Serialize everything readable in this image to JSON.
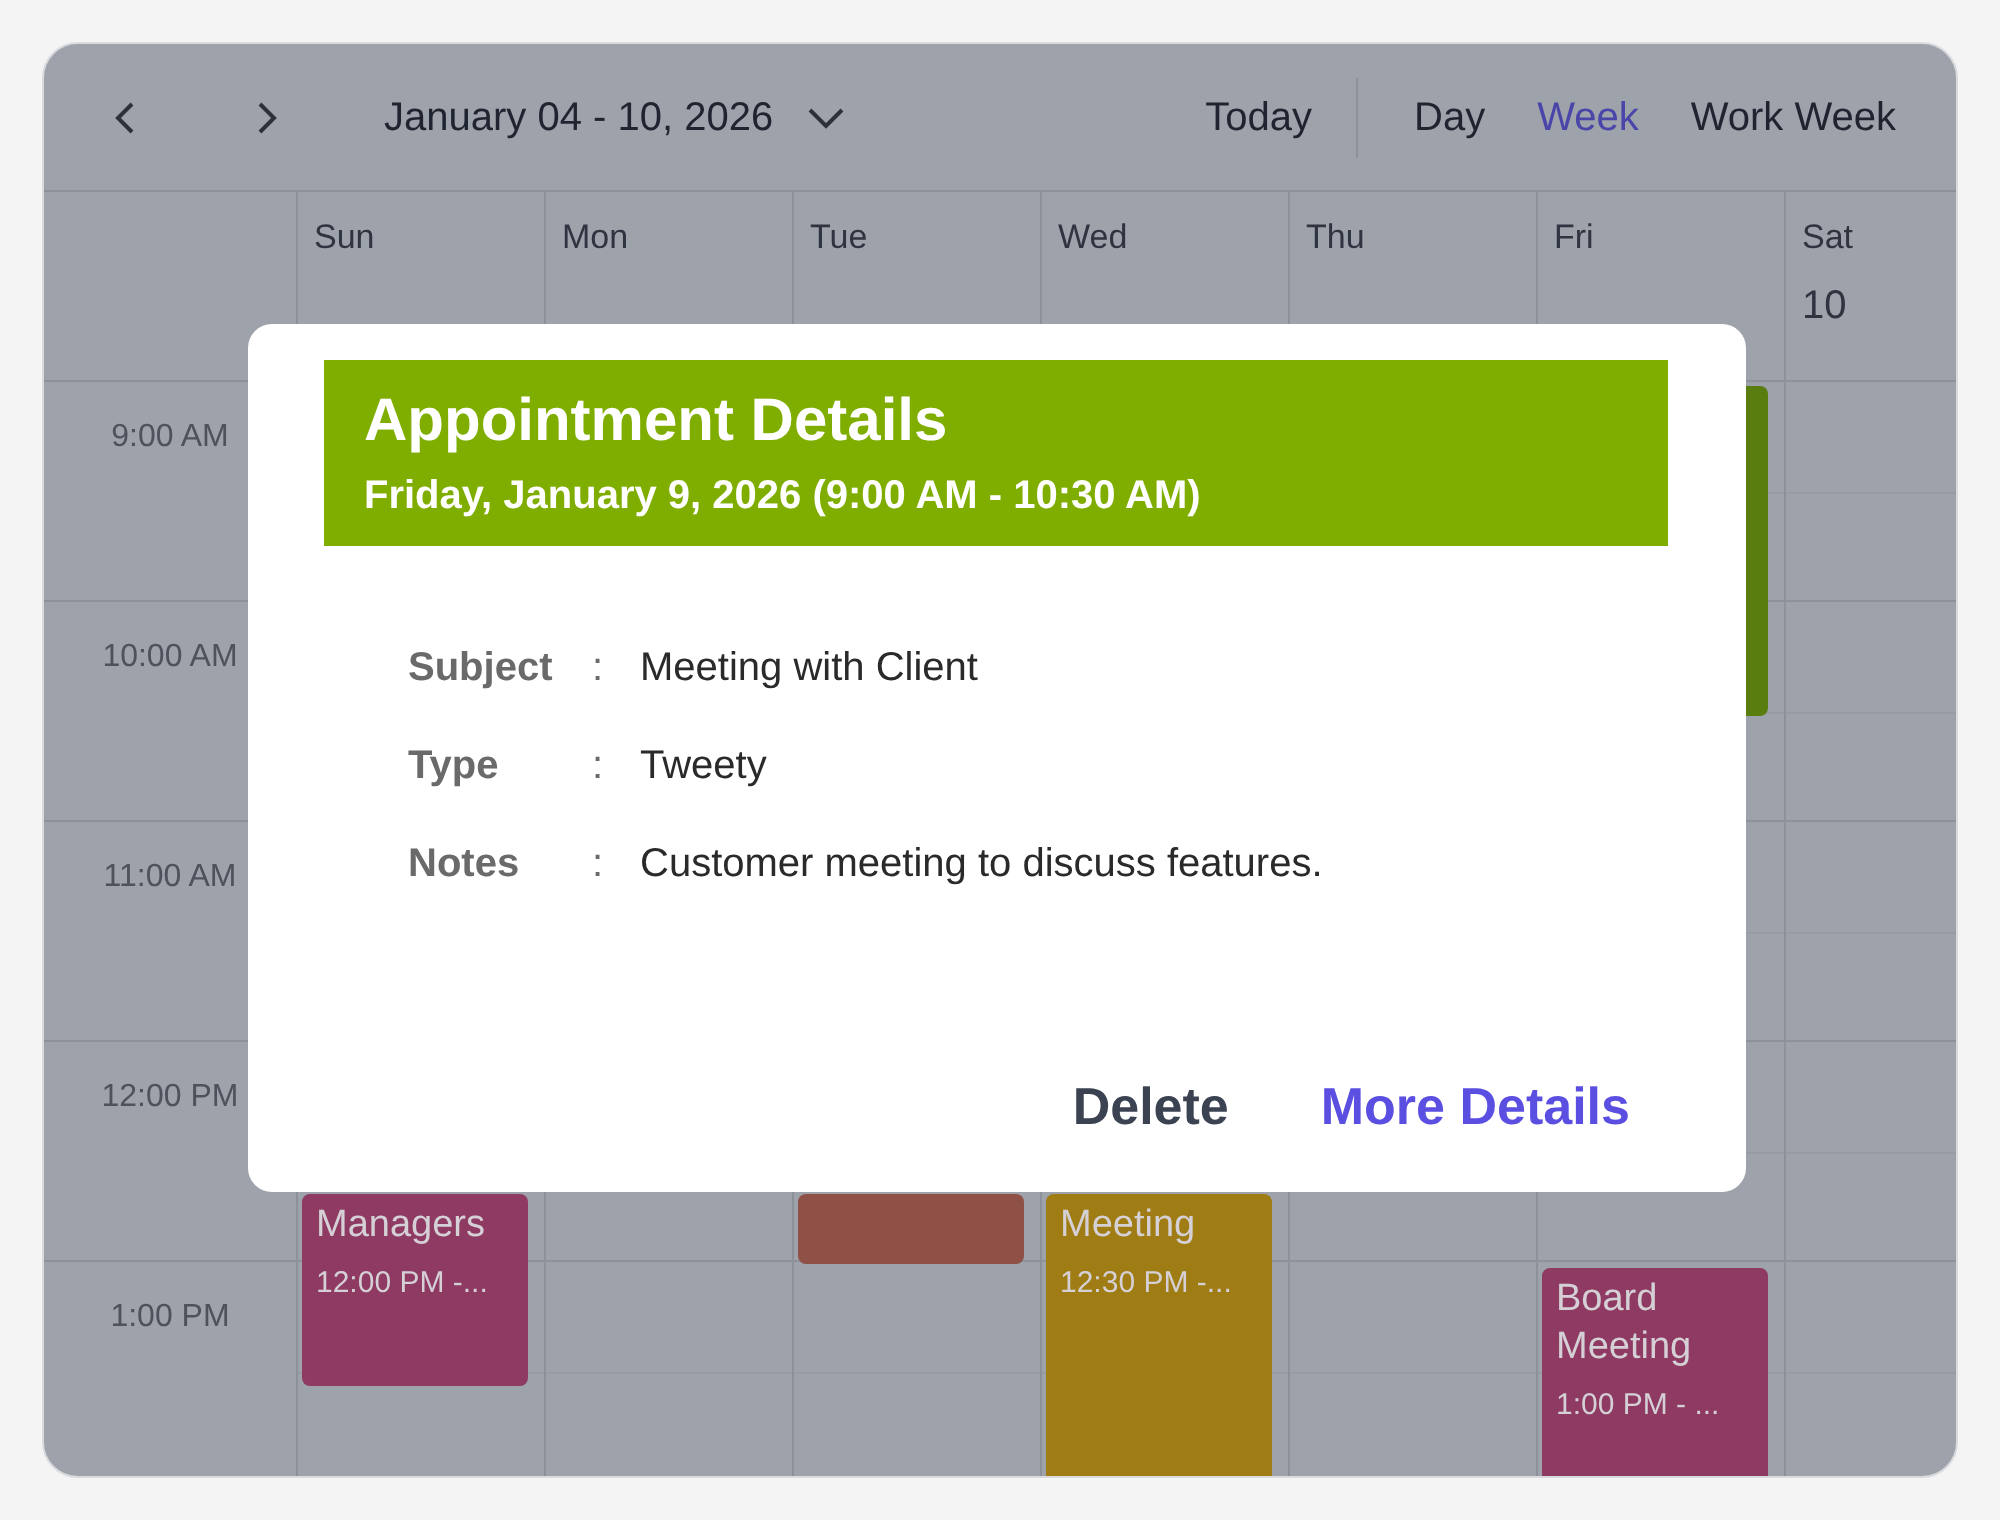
{
  "toolbar": {
    "date_range": "January 04 - 10, 2026",
    "today": "Today",
    "views": [
      {
        "label": "Day",
        "selected": false
      },
      {
        "label": "Week",
        "selected": true
      },
      {
        "label": "Work Week",
        "selected": false
      }
    ]
  },
  "days": [
    {
      "name": "Sun",
      "events": [
        {
          "title": "Managers",
          "time": "12:00 PM -...",
          "color": "#8e3a62"
        }
      ]
    },
    {
      "name": "Mon"
    },
    {
      "name": "Tue",
      "events": [
        {
          "color": "#8f5045"
        }
      ]
    },
    {
      "name": "Wed",
      "events": [
        {
          "title": "Meeting",
          "time": "12:30 PM -...",
          "color": "#a07c14"
        }
      ]
    },
    {
      "name": "Thu"
    },
    {
      "name": "Fri",
      "events": [
        {
          "color": "#5a7d10"
        },
        {
          "title": "Board Meeting",
          "time": "1:00 PM - ...",
          "color": "#8e3a62"
        }
      ]
    },
    {
      "name": "Sat",
      "date": "10"
    }
  ],
  "time_slots": [
    "9:00 AM",
    "10:00 AM",
    "11:00 AM",
    "12:00 PM",
    "1:00 PM"
  ],
  "dialog": {
    "title": "Appointment Details",
    "subtitle": "Friday, January 9, 2026 (9:00 AM - 10:30 AM)",
    "fields": [
      {
        "label": "Subject",
        "separator": ":",
        "value": "Meeting with Client"
      },
      {
        "label": "Type",
        "separator": ":",
        "value": "Tweety"
      },
      {
        "label": "Notes",
        "separator": ":",
        "value": "Customer meeting to discuss features."
      }
    ],
    "buttons": [
      {
        "label": "Delete",
        "kind": "secondary"
      },
      {
        "label": "More Details",
        "kind": "primary"
      }
    ]
  }
}
